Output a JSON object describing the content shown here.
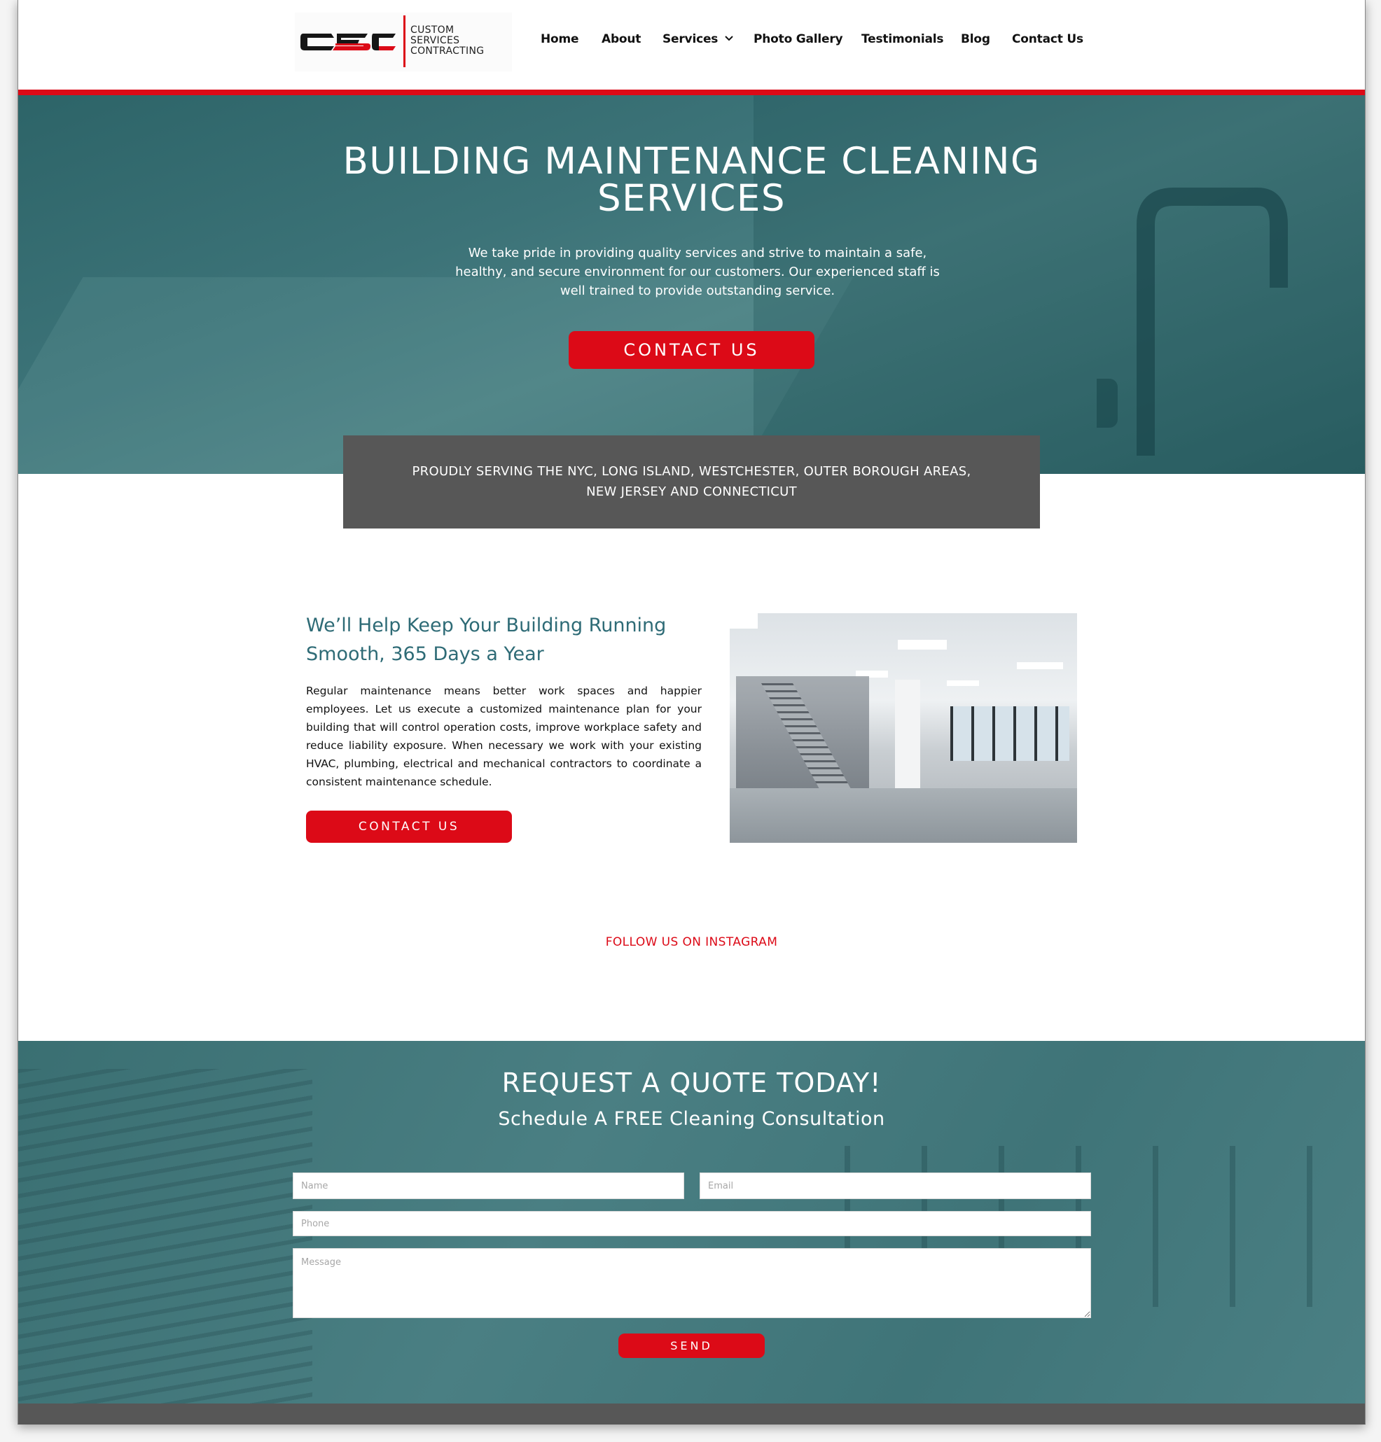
{
  "brand": {
    "logo_mark": "CSC",
    "logo_lines": [
      "CUSTOM",
      "SERVICES",
      "CONTRACTING"
    ],
    "colors": {
      "red": "#dc0a17",
      "teal": "#2e6b76",
      "gray": "#575757"
    }
  },
  "nav": {
    "items": [
      {
        "label": "Home"
      },
      {
        "label": "About"
      },
      {
        "label": "Services",
        "icon": "chevron-down-icon"
      },
      {
        "label": "Photo Gallery"
      },
      {
        "label": "Testimonials"
      },
      {
        "label": "Blog"
      },
      {
        "label": "Contact Us"
      }
    ]
  },
  "hero": {
    "title_line1": "BUILDING MAINTENANCE CLEANING",
    "title_line2": "SERVICES",
    "paragraph": "We take pride in providing quality services and strive to maintain a safe, healthy, and secure environment for our customers. Our experienced staff is well trained to provide outstanding service.",
    "cta_label": "CONTACT US"
  },
  "service_area": {
    "line1": "PROUDLY SERVING THE NYC, LONG ISLAND, WESTCHESTER, OUTER BOROUGH AREAS,",
    "line2": "NEW JERSEY AND CONNECTICUT"
  },
  "about": {
    "heading": "We’ll Help Keep Your Building Running Smooth, 365 Days a Year",
    "body": "Regular maintenance means better work spaces and happier employees. Let us execute a customized maintenance plan for your building that will control operation costs, improve workplace safety and reduce liability exposure. When necessary we work with your existing HVAC, plumbing, electrical and mechanical contractors to coordinate a consistent maintenance schedule.",
    "cta_label": "CONTACT US",
    "image_alt": "Empty office interior with glass staircase"
  },
  "instagram": {
    "label": "FOLLOW US ON INSTAGRAM"
  },
  "quote": {
    "title": "REQUEST A QUOTE TODAY!",
    "subtitle": "Schedule A FREE Cleaning Consultation",
    "fields": {
      "name": {
        "placeholder": "Name",
        "value": ""
      },
      "email": {
        "placeholder": "Email",
        "value": ""
      },
      "phone": {
        "placeholder": "Phone",
        "value": ""
      },
      "message": {
        "placeholder": "Message",
        "value": ""
      }
    },
    "send_label": "SEND"
  }
}
